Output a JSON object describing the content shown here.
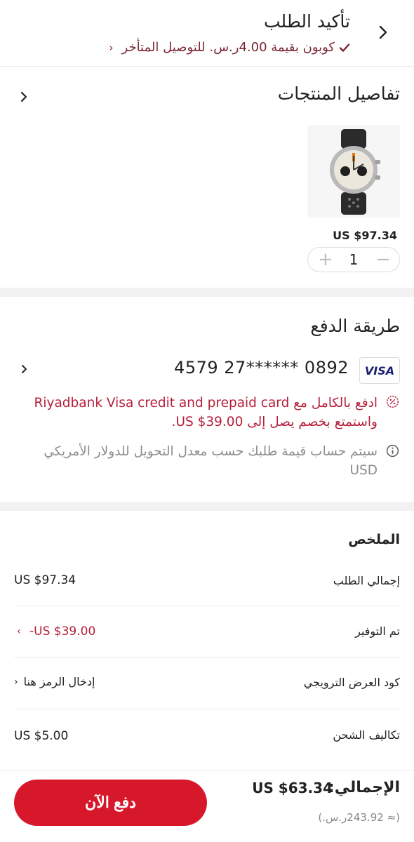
{
  "header": {
    "title": "تأكيد الطلب",
    "coupon_text": "كوبون بقيمة 4.00ر.س. للتوصيل المتأخر"
  },
  "products": {
    "title": "تفاصيل المنتجات",
    "items": [
      {
        "price": "US $97.34",
        "quantity": "1"
      }
    ]
  },
  "payment": {
    "title": "طريقة الدفع",
    "card_brand": "VISA",
    "card_number": "4579 27****** 0892",
    "promo_text": "ادفع بالكامل مع Riyadbank Visa credit and prepaid card واستمتع بخصم يصل إلى US $39.00.",
    "info_text": "سيتم حساب قيمة طلبك حسب معدل التحويل للدولار الأمريكي USD"
  },
  "summary": {
    "title": "الملخص",
    "rows": [
      {
        "label": "إجمالي الطلب",
        "value": "US $97.34"
      },
      {
        "label": "تم التوفير",
        "value": "-US $39.00"
      },
      {
        "label": "كود العرض الترويجي",
        "value": "إدخال الرمز هنا"
      },
      {
        "label": "تكاليف الشحن",
        "value": "US $5.00"
      }
    ]
  },
  "footer": {
    "total_label": "الإجمالي:",
    "total_value": "US $63.34",
    "total_sar": "(≈ 243.92ر.س.)",
    "pay_button": "دفع الآن"
  },
  "colors": {
    "accent": "#d7182a",
    "promo_text": "#b51f3a",
    "coupon_text": "#7a2532"
  }
}
